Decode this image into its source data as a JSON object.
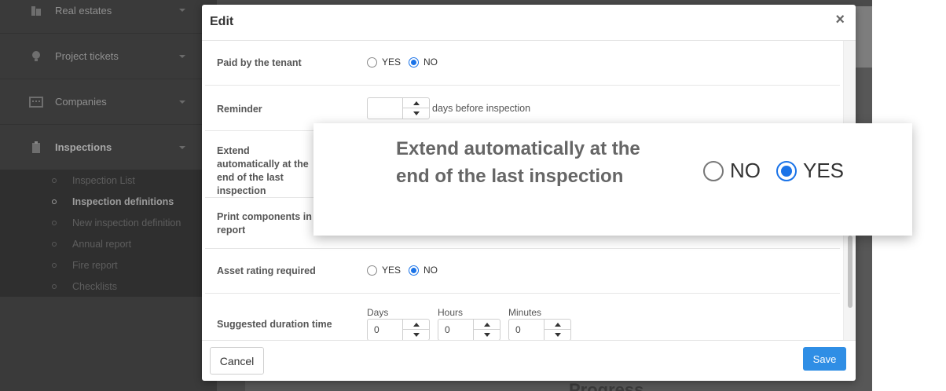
{
  "sidebar": {
    "items": [
      {
        "label": "Real estates",
        "icon": "building-icon"
      },
      {
        "label": "Project tickets",
        "icon": "lightbulb-icon"
      },
      {
        "label": "Companies",
        "icon": "companies-icon"
      },
      {
        "label": "Inspections",
        "icon": "clipboard-icon"
      }
    ],
    "subitems": [
      {
        "label": "Inspection List"
      },
      {
        "label": "Inspection definitions"
      },
      {
        "label": "New inspection definition"
      },
      {
        "label": "Annual report"
      },
      {
        "label": "Fire report"
      },
      {
        "label": "Checklists"
      }
    ]
  },
  "background": {
    "peek_text": "Progress"
  },
  "modal": {
    "title": "Edit",
    "close_glyph": "×",
    "fields": {
      "paid_by_tenant": {
        "label": "Paid by the tenant",
        "yes": "YES",
        "no": "NO",
        "selected": "NO"
      },
      "reminder": {
        "label": "Reminder",
        "value": "",
        "unit": "days before inspection"
      },
      "extend_auto": {
        "label": "Extend automatically at the end of the last inspection"
      },
      "print_components": {
        "label": "Print components in report"
      },
      "asset_rating": {
        "label": "Asset rating required",
        "yes": "YES",
        "no": "NO",
        "selected": "NO"
      },
      "duration": {
        "label": "Suggested duration time",
        "days_label": "Days",
        "days_value": "0",
        "hours_label": "Hours",
        "hours_value": "0",
        "minutes_label": "Minutes",
        "minutes_value": "0"
      }
    },
    "footer": {
      "cancel": "Cancel",
      "save": "Save"
    }
  },
  "zoom": {
    "label": "Extend automatically at the end of the last inspection",
    "no": "NO",
    "yes": "YES",
    "selected": "YES"
  },
  "colors": {
    "accent": "#1a73e8",
    "save_button": "#2f8ee5",
    "sidebar": "#3a3a3a"
  }
}
